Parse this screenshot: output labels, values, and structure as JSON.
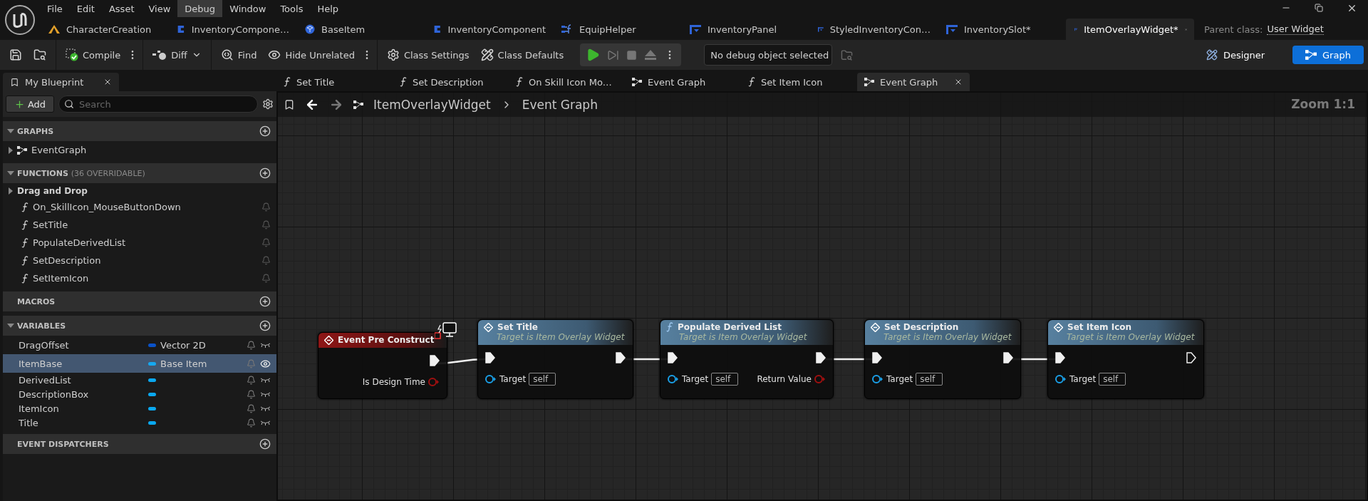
{
  "menu": [
    {
      "label": "File",
      "selected": false
    },
    {
      "label": "Edit",
      "selected": false
    },
    {
      "label": "Asset",
      "selected": false
    },
    {
      "label": "View",
      "selected": false
    },
    {
      "label": "Debug",
      "selected": true
    },
    {
      "label": "Window",
      "selected": false
    },
    {
      "label": "Tools",
      "selected": false
    },
    {
      "label": "Help",
      "selected": false
    }
  ],
  "asset_tabs": [
    {
      "label": "CharacterCreation",
      "kind": "level",
      "selected": false
    },
    {
      "label": "InventoryCompone…",
      "kind": "class",
      "selected": false
    },
    {
      "label": "BaseItem",
      "kind": "object",
      "selected": false
    },
    {
      "label": "InventoryComponent",
      "kind": "class",
      "selected": false
    },
    {
      "label": "EquipHelper",
      "kind": "library",
      "selected": false
    },
    {
      "label": "InventoryPanel",
      "kind": "widget",
      "selected": false
    },
    {
      "label": "StyledInventoryCon…",
      "kind": "widget",
      "selected": false
    },
    {
      "label": "InventorySlot*",
      "kind": "widget",
      "selected": false
    },
    {
      "label": "ItemOverlayWidget*",
      "kind": "widget",
      "selected": true
    }
  ],
  "parent_class": {
    "label": "Parent class:",
    "value": "User Widget"
  },
  "toolbar": {
    "compile": "Compile",
    "diff": "Diff",
    "find": "Find",
    "hide_unrelated": "Hide Unrelated",
    "class_settings": "Class Settings",
    "class_defaults": "Class Defaults",
    "debug_object": "No debug object selected"
  },
  "modes": [
    {
      "label": "Designer",
      "selected": false
    },
    {
      "label": "Graph",
      "selected": true
    }
  ],
  "my_blueprint": {
    "tab": "My Blueprint",
    "add": "Add",
    "search_placeholder": "Search",
    "sections": [
      {
        "title": "GRAPHS",
        "items": [
          {
            "label": "EventGraph",
            "kind": "graph"
          }
        ]
      },
      {
        "title": "FUNCTIONS",
        "note": "(36 OVERRIDABLE)",
        "category": "Drag and Drop",
        "items": [
          {
            "label": "On_SkillIcon_MouseButtonDown",
            "kind": "function"
          },
          {
            "label": "SetTitle",
            "kind": "function"
          },
          {
            "label": "PopulateDerivedList",
            "kind": "function"
          },
          {
            "label": "SetDescription",
            "kind": "function"
          },
          {
            "label": "SetItemIcon",
            "kind": "function"
          }
        ]
      },
      {
        "title": "MACROS"
      },
      {
        "title": "VARIABLES",
        "variables": [
          {
            "name": "DragOffset",
            "type": "Vector 2D",
            "color": "#0a52c8",
            "selected": false,
            "visible": false
          },
          {
            "name": "ItemBase",
            "type": "Base Item",
            "color": "#16a8f0",
            "selected": true,
            "visible": true
          },
          {
            "name": "DerivedList",
            "color": "#0aa8f0",
            "selected": false,
            "visible": false
          },
          {
            "name": "DescriptionBox",
            "color": "#0aa8f0",
            "selected": false,
            "visible": false
          },
          {
            "name": "ItemIcon",
            "color": "#0aa8f0",
            "selected": false,
            "visible": false
          },
          {
            "name": "Title",
            "color": "#0aa8f0",
            "selected": false,
            "visible": false
          }
        ]
      },
      {
        "title": "EVENT DISPATCHERS"
      }
    ]
  },
  "graph_tabs": [
    {
      "label": "Set Title",
      "kind": "function",
      "selected": false
    },
    {
      "label": "Set Description",
      "kind": "function",
      "selected": false
    },
    {
      "label": "On Skill Icon Mo…",
      "kind": "function",
      "selected": false
    },
    {
      "label": "Event Graph",
      "kind": "graph",
      "selected": false
    },
    {
      "label": "Set Item Icon",
      "kind": "function",
      "selected": false
    },
    {
      "label": "Event Graph",
      "kind": "graph",
      "selected": true
    }
  ],
  "breadcrumb": {
    "path": "ItemOverlayWidget",
    "current": "Event Graph"
  },
  "zoom": "Zoom 1:1",
  "nodes": [
    {
      "kind": "event",
      "title": "Event Pre Construct",
      "exec_out_connected": true,
      "outputs": [
        "Is Design Time"
      ]
    },
    {
      "kind": "call",
      "title": "Set Title",
      "subtitle": "Target is Item Overlay Widget",
      "target_label": "Target",
      "target": "self",
      "exec_out_connected": true
    },
    {
      "kind": "function",
      "title": "Populate Derived List",
      "subtitle": "Target is Item Overlay Widget",
      "target_label": "Target",
      "target": "self",
      "exec_out_connected": true,
      "outputs": [
        "Return Value"
      ]
    },
    {
      "kind": "call",
      "title": "Set Description",
      "subtitle": "Target is Item Overlay Widget",
      "target_label": "Target",
      "target": "self",
      "exec_out_connected": true
    },
    {
      "kind": "call",
      "title": "Set Item Icon",
      "subtitle": "Target is Item Overlay Widget",
      "target_label": "Target",
      "target": "self",
      "exec_out_connected": false
    }
  ]
}
